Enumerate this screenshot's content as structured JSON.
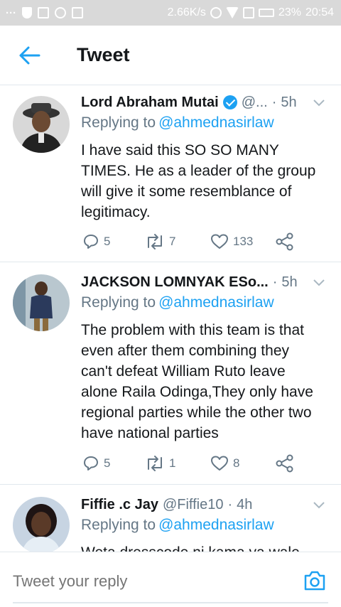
{
  "status_bar": {
    "left_dots": "···",
    "speed": "2.66K/s",
    "battery": "23%",
    "time": "20:54"
  },
  "header": {
    "title": "Tweet",
    "back_icon": "arrow-left-icon"
  },
  "colors": {
    "accent": "#1da1f2",
    "secondary_text": "#657786",
    "divider": "#e1e8ed"
  },
  "tweets": [
    {
      "name": "Lord Abraham Mutai",
      "verified": true,
      "handle": "@...",
      "time": "5h",
      "replying_label": "Replying to",
      "replying_handle": "@ahmednasirlaw",
      "text": "I have said this SO SO MANY TIMES. He as a leader of the group will give it some resemblance of legitimacy.",
      "replies": "5",
      "retweets": "7",
      "likes": "133"
    },
    {
      "name": "JACKSON LOMNYAK ESo...",
      "verified": false,
      "handle": "",
      "time": "5h",
      "replying_label": "Replying to",
      "replying_handle": "@ahmednasirlaw",
      "text": "The problem with this team is that even after them combining they can't defeat William Ruto leave alone Raila Odinga,They only have regional parties while the other two have national parties",
      "replies": "5",
      "retweets": "1",
      "likes": "8"
    },
    {
      "name": "Fiffie .c Jay",
      "verified": false,
      "handle": "@Fiffie10",
      "time": "4h",
      "replying_label": "Replying to",
      "replying_handle": "@ahmednasirlaw",
      "text": "Weta dresscode ni kama ya wale"
    }
  ],
  "reply_bar": {
    "placeholder": "Tweet your reply",
    "camera_icon": "camera-icon"
  }
}
